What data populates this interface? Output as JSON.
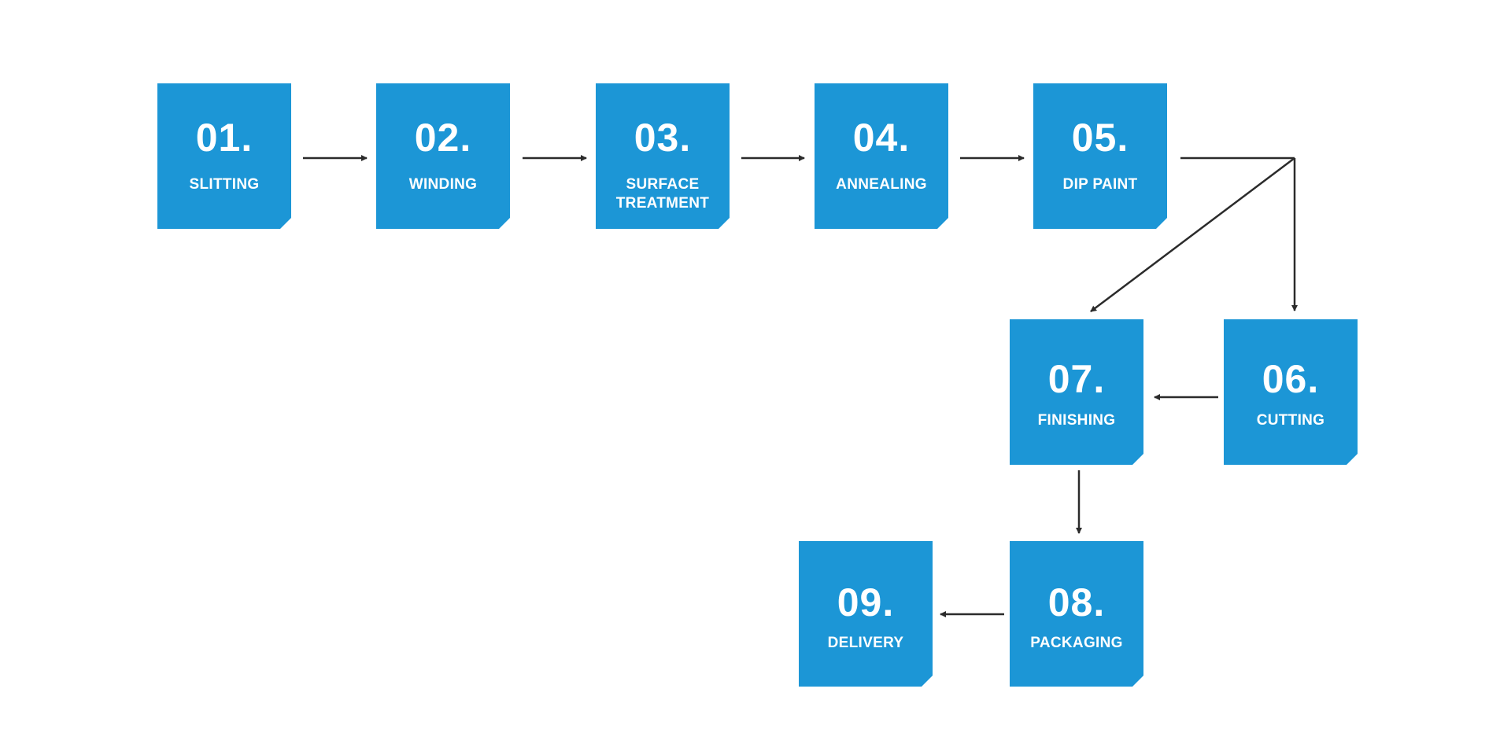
{
  "diagram": {
    "type": "process-flow",
    "accent_color": "#1c96d6",
    "connector_color": "#2b2b2b",
    "steps": [
      {
        "id": "s1",
        "number": "01.",
        "label": "SLITTING"
      },
      {
        "id": "s2",
        "number": "02.",
        "label": "WINDING"
      },
      {
        "id": "s3",
        "number": "03.",
        "label": "SURFACE TREATMENT"
      },
      {
        "id": "s4",
        "number": "04.",
        "label": "ANNEALING"
      },
      {
        "id": "s5",
        "number": "05.",
        "label": "DIP PAINT"
      },
      {
        "id": "s6",
        "number": "06.",
        "label": "CUTTING"
      },
      {
        "id": "s7",
        "number": "07.",
        "label": "FINISHING"
      },
      {
        "id": "s8",
        "number": "08.",
        "label": "PACKAGING"
      },
      {
        "id": "s9",
        "number": "09.",
        "label": "DELIVERY"
      }
    ],
    "connections": [
      {
        "from": "01.",
        "to": "02."
      },
      {
        "from": "02.",
        "to": "03."
      },
      {
        "from": "03.",
        "to": "04."
      },
      {
        "from": "04.",
        "to": "05."
      },
      {
        "from": "05.",
        "to": "06."
      },
      {
        "from": "05.",
        "to": "07."
      },
      {
        "from": "06.",
        "to": "07."
      },
      {
        "from": "07.",
        "to": "08."
      },
      {
        "from": "08.",
        "to": "09."
      }
    ]
  }
}
